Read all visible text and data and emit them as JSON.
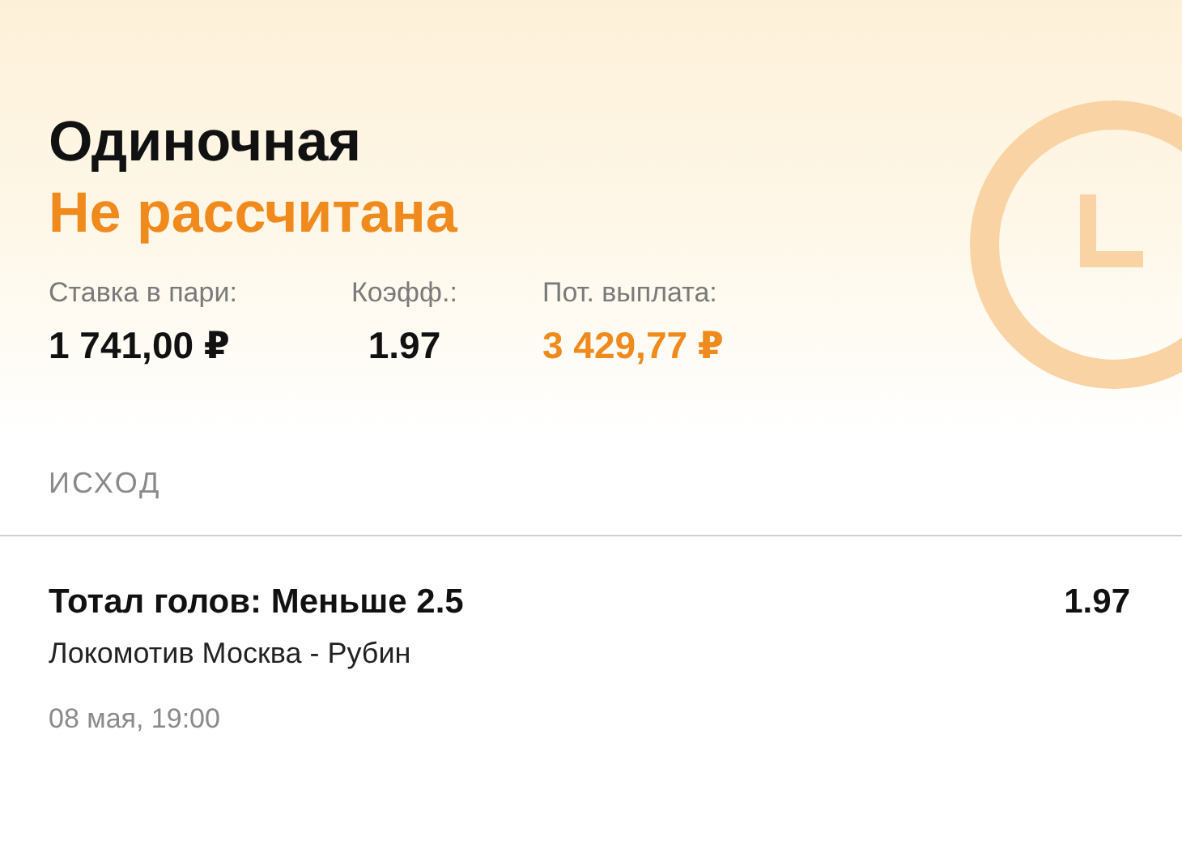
{
  "bet": {
    "type": "Одиночная",
    "status": "Не рассчитана"
  },
  "stats": [
    {
      "label": "Ставка в пари:",
      "value": "1 741,00 ₽",
      "accent": false
    },
    {
      "label": "Коэфф.:",
      "value": "1.97",
      "accent": false
    },
    {
      "label": "Пот. выплата:",
      "value": "3 429,77 ₽",
      "accent": true
    }
  ],
  "section_title": "ИСХОД",
  "outcome": {
    "market": "Тотал голов: Меньше 2.5",
    "odds": "1.97",
    "event": "Локомотив Москва - Рубин",
    "date": "08 мая, 19:00"
  }
}
